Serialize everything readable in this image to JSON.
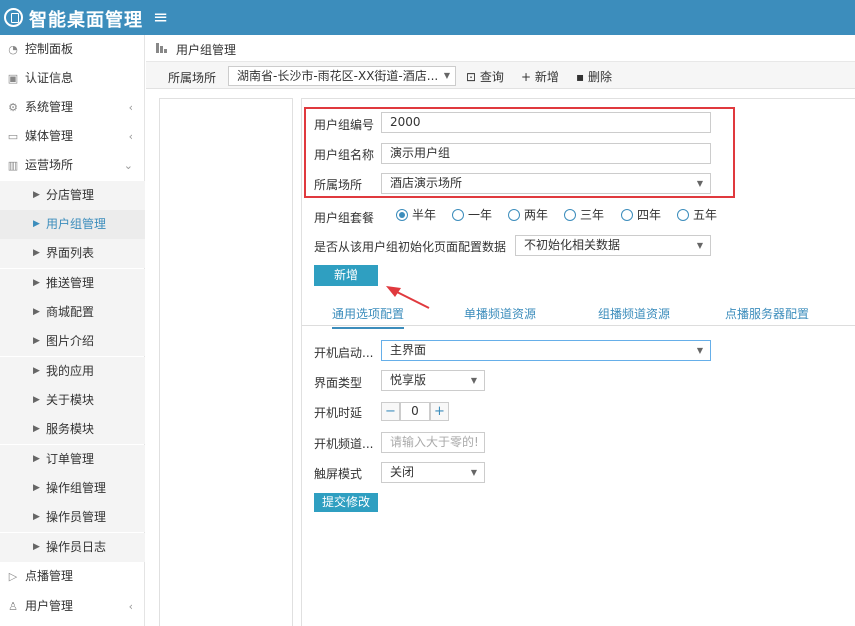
{
  "app": {
    "title": "智能桌面管理"
  },
  "sidebar": {
    "items": [
      {
        "label": "控制面板",
        "icon": "dashboard-icon"
      },
      {
        "label": "认证信息",
        "icon": "id-card-icon"
      },
      {
        "label": "系统管理",
        "icon": "gear-icon",
        "expandable": true
      },
      {
        "label": "媒体管理",
        "icon": "monitor-icon",
        "expandable": true
      },
      {
        "label": "运营场所",
        "icon": "building-icon",
        "expanded": true
      }
    ],
    "subitems": [
      "分店管理",
      "用户组管理",
      "界面列表",
      "推送管理",
      "商城配置",
      "图片介绍",
      "我的应用",
      "关于模块",
      "服务模块",
      "订单管理",
      "操作组管理",
      "操作员管理",
      "操作员日志"
    ],
    "active_subitem": "用户组管理",
    "bottom_items": [
      {
        "label": "点播管理",
        "icon": "play-icon"
      },
      {
        "label": "用户管理",
        "icon": "user-icon",
        "expandable": true
      }
    ]
  },
  "breadcrumb": {
    "text": "用户组管理"
  },
  "toolbar": {
    "venue_label": "所属场所",
    "venue_value": "湖南省-长沙市-雨花区-XX街道-酒店...",
    "query_label": "查询",
    "add_label": "新增",
    "delete_label": "删除"
  },
  "form": {
    "group_id_label": "用户组编号",
    "group_id_value": "2000",
    "group_name_label": "用户组名称",
    "group_name_value": "演示用户组",
    "venue_label": "所属场所",
    "venue_value": "酒店演示场所",
    "package_label": "用户组套餐",
    "package_options": [
      "半年",
      "一年",
      "两年",
      "三年",
      "四年",
      "五年"
    ],
    "package_selected": "半年",
    "init_label": "是否从该用户组初始化页面配置数据",
    "init_value": "不初始化相关数据",
    "submit_label": "新增"
  },
  "tabs": [
    "通用选项配置",
    "单播频道资源",
    "组播频道资源",
    "点播服务器配置"
  ],
  "active_tab": "通用选项配置",
  "settings": {
    "boot_label": "开机启动...",
    "boot_value": "主界面",
    "ui_type_label": "界面类型",
    "ui_type_value": "悦享版",
    "delay_label": "开机时延",
    "delay_value": "0",
    "boot_channel_label": "开机频道...",
    "boot_channel_placeholder": "请输入大于零的!",
    "touch_label": "触屏模式",
    "touch_value": "关闭",
    "submit_label": "提交修改"
  },
  "colors": {
    "brand": "#3c8dbc",
    "button": "#2f9fc1",
    "highlight": "#e0393e"
  }
}
